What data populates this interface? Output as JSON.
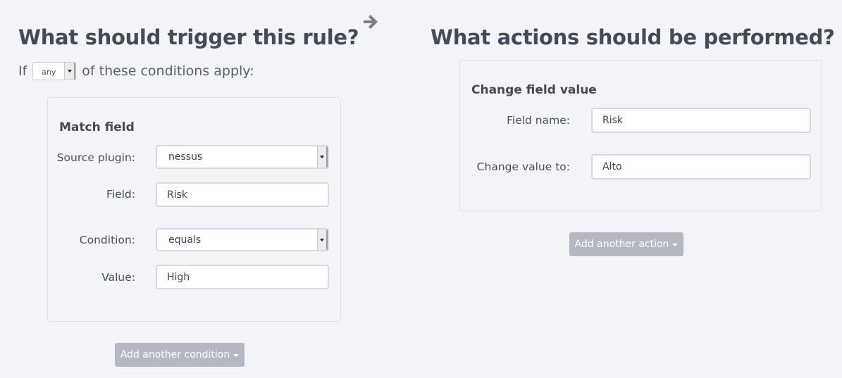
{
  "trigger": {
    "title": "What should trigger this rule?",
    "if_prefix": "If",
    "match_mode": "any",
    "if_suffix": "of these conditions apply:",
    "condition_panel": {
      "title": "Match field",
      "source_plugin": {
        "label": "Source plugin:",
        "value": "nessus"
      },
      "field": {
        "label": "Field:",
        "value": "Risk"
      },
      "condition": {
        "label": "Condition:",
        "value": "equals"
      },
      "value": {
        "label": "Value:",
        "value": "High"
      }
    },
    "add_button": "Add another condition"
  },
  "arrow_icon": "arrow-right-icon",
  "actions": {
    "title": "What actions should be performed?",
    "action_panel": {
      "title": "Change field value",
      "field_name": {
        "label": "Field name:",
        "value": "Risk"
      },
      "change_value": {
        "label": "Change value to:",
        "value": "Alto"
      }
    },
    "add_button": "Add another action"
  }
}
